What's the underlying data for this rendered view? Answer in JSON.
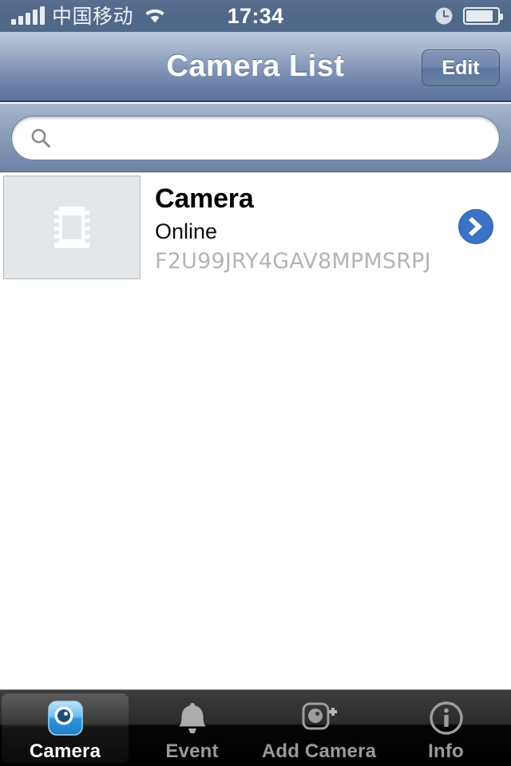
{
  "status_bar": {
    "carrier": "中国移动",
    "time": "17:34",
    "signal_bars": 5,
    "signal_icon": "signal-bars-icon",
    "wifi_icon": "wifi-icon",
    "alarm_icon": "clock-icon",
    "battery_icon": "battery-icon",
    "battery_level": "78%"
  },
  "nav_bar": {
    "title": "Camera List",
    "edit_label": "Edit"
  },
  "search": {
    "value": "",
    "placeholder": "",
    "icon": "search-icon"
  },
  "list": {
    "rows": [
      {
        "thumbnail_icon": "film-strip-icon",
        "title": "Camera",
        "status": "Online",
        "serial": "F2U99JRY4GAV8MPMSRPJ",
        "disclosure_icon": "chevron-right-icon"
      }
    ]
  },
  "tab_bar": {
    "selected_index": 0,
    "items": [
      {
        "label": "Camera",
        "icon": "camera-app-icon"
      },
      {
        "label": "Event",
        "icon": "bell-icon"
      },
      {
        "label": "Add Camera",
        "icon": "add-camera-icon"
      },
      {
        "label": "Info",
        "icon": "info-circle-icon"
      }
    ]
  },
  "colors": {
    "nav_bar_top": "#bcc9dc",
    "nav_bar_bottom": "#5c759f",
    "status_bar": "#4e6888",
    "accent_blue": "#2f6fd0",
    "serial_gray": "#b4b4b4",
    "tab_bar_black": "#000000",
    "tab_label_inactive": "#9a9a9a",
    "tab_label_active": "#ffffff"
  }
}
